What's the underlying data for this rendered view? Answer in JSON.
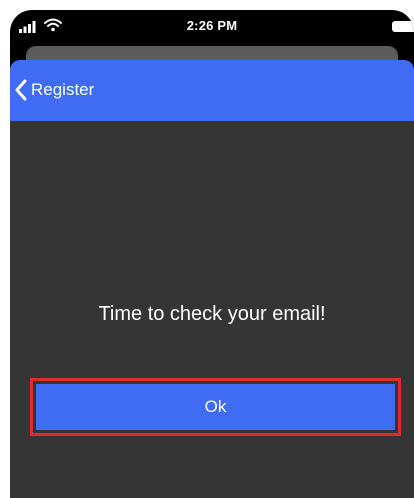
{
  "status_bar": {
    "time": "2:26 PM",
    "signal_icon": "cellular-signal-icon",
    "wifi_icon": "wifi-icon",
    "battery_icon": "battery-icon"
  },
  "nav": {
    "back_label": "Register",
    "back_icon": "chevron-left-icon"
  },
  "content": {
    "message": "Time to check your email!",
    "ok_label": "Ok"
  },
  "colors": {
    "accent": "#3f6cf3",
    "background": "#353535",
    "highlight_outline": "#e02b2b"
  }
}
